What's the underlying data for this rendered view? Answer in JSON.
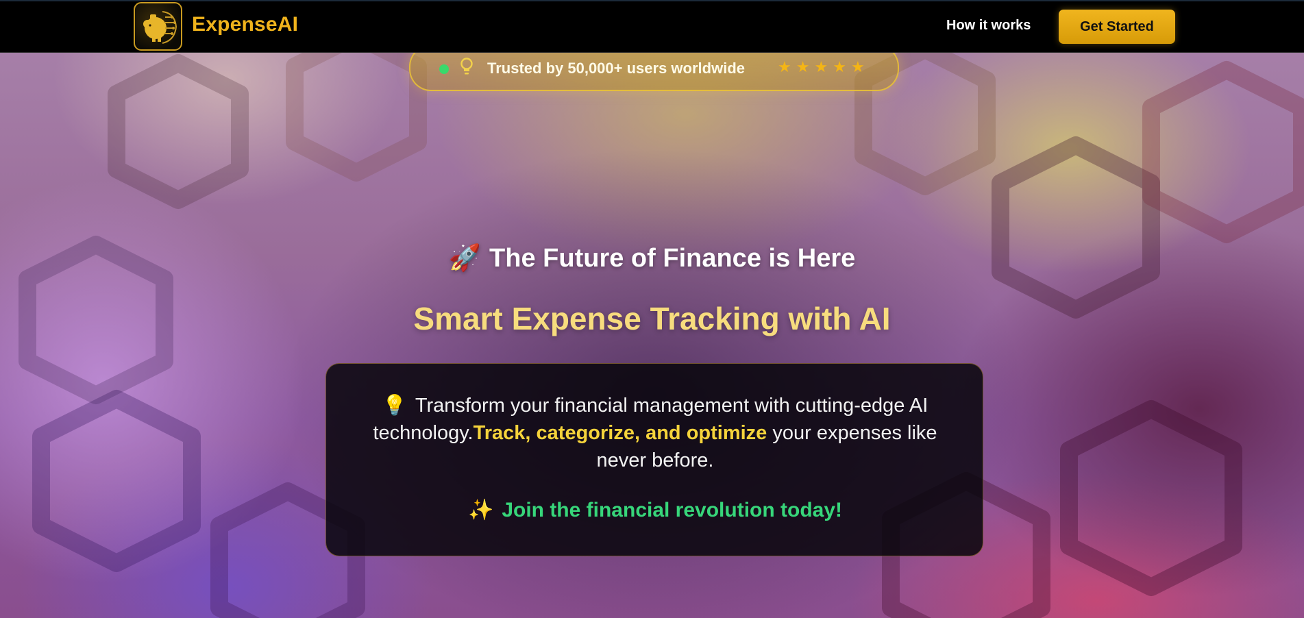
{
  "brand": {
    "name": "ExpenseAI",
    "logo_icon": "piggy-bank-circuit-icon"
  },
  "nav": {
    "links": [
      {
        "label": "How it works"
      }
    ],
    "cta_label": "Get Started"
  },
  "trust_badge": {
    "text": "Trusted by 50,000+ users worldwide",
    "rating": 5,
    "rating_max": 5,
    "star_glyph": "★",
    "status_color": "#39d96b"
  },
  "hero": {
    "eyebrow_emoji": "🚀",
    "eyebrow": "The Future of Finance is Here",
    "headline": "Smart Expense Tracking with AI",
    "description": {
      "emoji": "💡",
      "part1": "Transform your financial management with cutting-edge AI technology.",
      "highlight": "Track, categorize, and optimize",
      "part2": " your expenses like never before."
    },
    "join_emoji": "✨",
    "join_text": "Join the financial revolution today!"
  },
  "colors": {
    "brand_gold": "#f0b31c",
    "headline_yellow": "#f7dc7e",
    "highlight_yellow": "#f5d33b",
    "join_green": "#37d67a"
  }
}
